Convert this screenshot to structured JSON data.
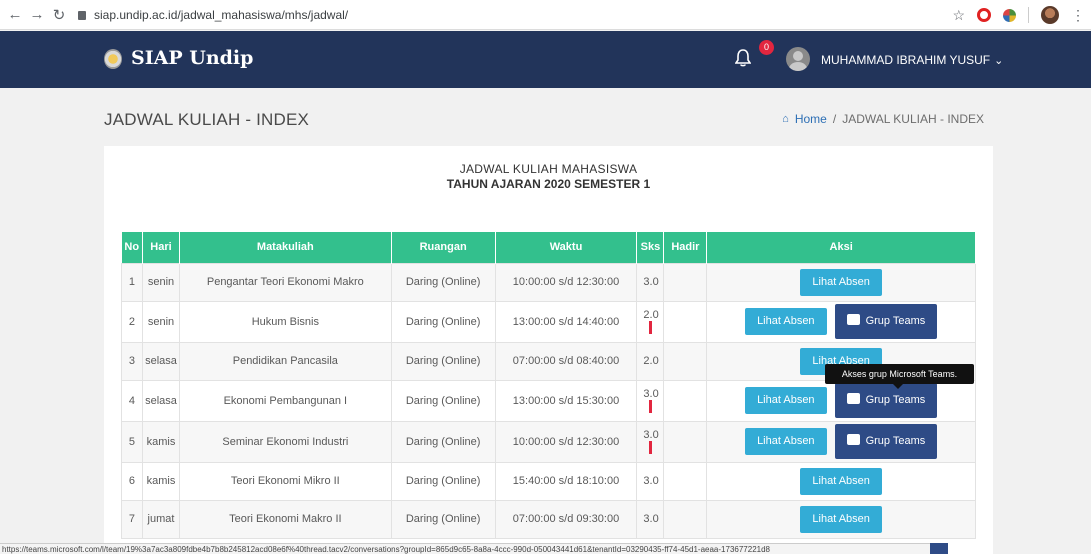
{
  "browser": {
    "url": "siap.undip.ac.id/jadwal_mahasiswa/mhs/jadwal/"
  },
  "header": {
    "brand": "SIAP Undip",
    "notification_count": "0",
    "user_name": "MUHAMMAD IBRAHIM YUSUF"
  },
  "page": {
    "title": "JADWAL KULIAH - INDEX",
    "breadcrumb_home": "Home",
    "breadcrumb_sep": "/",
    "breadcrumb_current": "JADWAL KULIAH - INDEX"
  },
  "card": {
    "title": "JADWAL KULIAH MAHASISWA",
    "subtitle": "TAHUN AJARAN 2020 SEMESTER 1"
  },
  "table": {
    "headers": [
      "No",
      "Hari",
      "Matakuliah",
      "Ruangan",
      "Waktu",
      "Sks",
      "Hadir",
      "Aksi"
    ],
    "rows": [
      {
        "no": "1",
        "hari": "senin",
        "matakuliah": "Pengantar Teori Ekonomi Makro",
        "ruangan": "Daring (Online)",
        "waktu": "10:00:00 s/d 12:30:00",
        "sks": "3.0",
        "absen": "Lihat Absen",
        "teams": ""
      },
      {
        "no": "2",
        "hari": "senin",
        "matakuliah": "Hukum Bisnis",
        "ruangan": "Daring (Online)",
        "waktu": "13:00:00 s/d 14:40:00",
        "sks": "2.0",
        "absen": "Lihat Absen",
        "teams": "Grup Teams"
      },
      {
        "no": "3",
        "hari": "selasa",
        "matakuliah": "Pendidikan Pancasila",
        "ruangan": "Daring (Online)",
        "waktu": "07:00:00 s/d 08:40:00",
        "sks": "2.0",
        "absen": "Lihat Absen",
        "teams": ""
      },
      {
        "no": "4",
        "hari": "selasa",
        "matakuliah": "Ekonomi Pembangunan I",
        "ruangan": "Daring (Online)",
        "waktu": "13:00:00 s/d 15:30:00",
        "sks": "3.0",
        "absen": "Lihat Absen",
        "teams": "Grup Teams"
      },
      {
        "no": "5",
        "hari": "kamis",
        "matakuliah": "Seminar Ekonomi Industri",
        "ruangan": "Daring (Online)",
        "waktu": "10:00:00 s/d 12:30:00",
        "sks": "3.0",
        "absen": "Lihat Absen",
        "teams": "Grup Teams"
      },
      {
        "no": "6",
        "hari": "kamis",
        "matakuliah": "Teori Ekonomi Mikro II",
        "ruangan": "Daring (Online)",
        "waktu": "15:40:00 s/d 18:10:00",
        "sks": "3.0",
        "absen": "Lihat Absen",
        "teams": ""
      },
      {
        "no": "7",
        "hari": "jumat",
        "matakuliah": "Teori Ekonomi Makro II",
        "ruangan": "Daring (Online)",
        "waktu": "07:00:00 s/d 09:30:00",
        "sks": "3.0",
        "absen": "Lihat Absen",
        "teams": ""
      }
    ]
  },
  "tooltip": "Akses grup Microsoft Teams.",
  "status_url": "https://teams.microsoft.com/l/team/19%3a7ac3a809fdbe4b7b8b245812acd08e6f%40thread.tacv2/conversations?groupId=865d9c65-8a8a-4ccc-990d-050043441d61&tenantId=03290435-ff74-45d1-aeaa-173677221d8",
  "colors": {
    "header_bg": "#22345a",
    "table_header": "#33c08d",
    "absen_button": "#33acd6",
    "teams_button": "#2e4b86"
  }
}
